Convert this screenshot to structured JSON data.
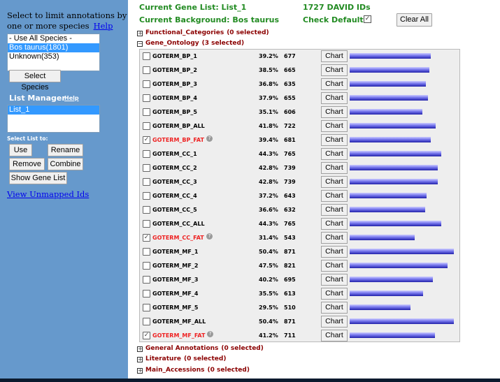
{
  "sidebar": {
    "species_prompt": "Select to limit annotations by one or more species",
    "species_help": "Help",
    "species_options": [
      {
        "label": "- Use All Species -",
        "selected": false
      },
      {
        "label": "Bos taurus(1801)",
        "selected": true
      },
      {
        "label": "Unknown(353)",
        "selected": false
      }
    ],
    "select_species_button": "Select Species",
    "list_manager_title": "List Manager",
    "list_manager_help": "Help",
    "lists": [
      {
        "label": "List_1",
        "selected": true
      }
    ],
    "select_list_to": "Select List to:",
    "use_button": "Use",
    "rename_button": "Rename",
    "remove_button": "Remove",
    "combine_button": "Combine",
    "show_gene_list_button": "Show Gene List",
    "unmapped_link": "View Unmapped Ids"
  },
  "header": {
    "gene_list": "Current Gene List: List_1",
    "background": "Current Background: Bos taurus",
    "david_ids": "1727 DAVID IDs",
    "check_defaults": "Check Defaults",
    "check_defaults_checked": true,
    "clear_all": "Clear All"
  },
  "categories": {
    "functional": {
      "name": "Functional_Categories",
      "count": "(0 selected)"
    },
    "gene_ontology": {
      "name": "Gene_Ontology",
      "count": "(3 selected)"
    },
    "general": {
      "name": "General Annotations",
      "count": "(0 selected)"
    },
    "literature": {
      "name": "Literature",
      "count": "(0 selected)"
    },
    "main_accessions": {
      "name": "Main_Accessions",
      "count": "(0 selected)"
    }
  },
  "chart_button_label": "Chart",
  "go_terms": [
    {
      "term": "GOTERM_BP_1",
      "percent": "39.2%",
      "count": "677",
      "checked": false,
      "highlight": false
    },
    {
      "term": "GOTERM_BP_2",
      "percent": "38.5%",
      "count": "665",
      "checked": false,
      "highlight": false
    },
    {
      "term": "GOTERM_BP_3",
      "percent": "36.8%",
      "count": "635",
      "checked": false,
      "highlight": false
    },
    {
      "term": "GOTERM_BP_4",
      "percent": "37.9%",
      "count": "655",
      "checked": false,
      "highlight": false
    },
    {
      "term": "GOTERM_BP_5",
      "percent": "35.1%",
      "count": "606",
      "checked": false,
      "highlight": false
    },
    {
      "term": "GOTERM_BP_ALL",
      "percent": "41.8%",
      "count": "722",
      "checked": false,
      "highlight": false
    },
    {
      "term": "GOTERM_BP_FAT",
      "percent": "39.4%",
      "count": "681",
      "checked": true,
      "highlight": true
    },
    {
      "term": "GOTERM_CC_1",
      "percent": "44.3%",
      "count": "765",
      "checked": false,
      "highlight": false
    },
    {
      "term": "GOTERM_CC_2",
      "percent": "42.8%",
      "count": "739",
      "checked": false,
      "highlight": false
    },
    {
      "term": "GOTERM_CC_3",
      "percent": "42.8%",
      "count": "739",
      "checked": false,
      "highlight": false
    },
    {
      "term": "GOTERM_CC_4",
      "percent": "37.2%",
      "count": "643",
      "checked": false,
      "highlight": false
    },
    {
      "term": "GOTERM_CC_5",
      "percent": "36.6%",
      "count": "632",
      "checked": false,
      "highlight": false
    },
    {
      "term": "GOTERM_CC_ALL",
      "percent": "44.3%",
      "count": "765",
      "checked": false,
      "highlight": false
    },
    {
      "term": "GOTERM_CC_FAT",
      "percent": "31.4%",
      "count": "543",
      "checked": true,
      "highlight": true
    },
    {
      "term": "GOTERM_MF_1",
      "percent": "50.4%",
      "count": "871",
      "checked": false,
      "highlight": false
    },
    {
      "term": "GOTERM_MF_2",
      "percent": "47.5%",
      "count": "821",
      "checked": false,
      "highlight": false
    },
    {
      "term": "GOTERM_MF_3",
      "percent": "40.2%",
      "count": "695",
      "checked": false,
      "highlight": false
    },
    {
      "term": "GOTERM_MF_4",
      "percent": "35.5%",
      "count": "613",
      "checked": false,
      "highlight": false
    },
    {
      "term": "GOTERM_MF_5",
      "percent": "29.5%",
      "count": "510",
      "checked": false,
      "highlight": false
    },
    {
      "term": "GOTERM_MF_ALL",
      "percent": "50.4%",
      "count": "871",
      "checked": false,
      "highlight": false
    },
    {
      "term": "GOTERM_MF_FAT",
      "percent": "41.2%",
      "count": "711",
      "checked": true,
      "highlight": true
    }
  ]
}
